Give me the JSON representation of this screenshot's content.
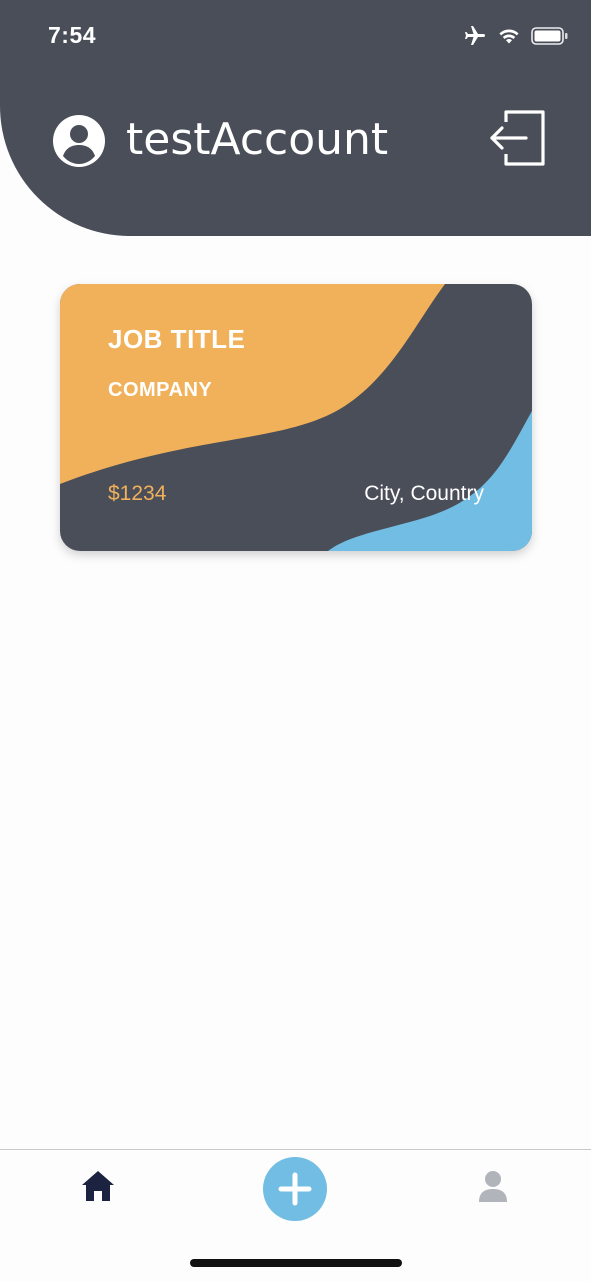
{
  "status_bar": {
    "time": "7:54",
    "icons": [
      "airplane-icon",
      "wifi-icon",
      "battery-icon"
    ]
  },
  "header": {
    "username": "testAccount",
    "avatar_icon": "user-circle-icon",
    "logout_icon": "logout-icon"
  },
  "job_card": {
    "title": "JOB TITLE",
    "company": "COMPANY",
    "salary": "$1234",
    "location": "City, Country"
  },
  "tab_bar": {
    "items": [
      {
        "icon": "home-icon",
        "active": true
      },
      {
        "icon": "plus-icon",
        "active": false
      },
      {
        "icon": "person-icon",
        "active": false
      }
    ]
  },
  "colors": {
    "header_bg": "#4a4e59",
    "card_orange": "#f1b15a",
    "card_dark": "#4a4e59",
    "card_blue": "#72bde3",
    "tab_active": "#1c2340",
    "tab_inactive": "#b2b4bb"
  }
}
